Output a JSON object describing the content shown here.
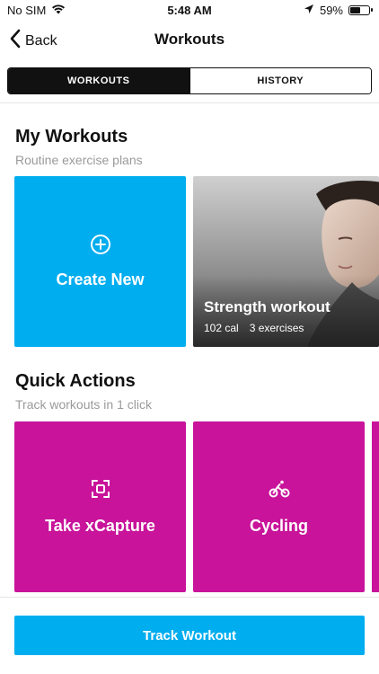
{
  "status_bar": {
    "carrier": "No SIM",
    "time": "5:48 AM",
    "battery": "59%",
    "battery_level": 0.59
  },
  "nav": {
    "back_label": "Back",
    "title": "Workouts"
  },
  "tabs": [
    {
      "label": "WORKOUTS",
      "active": true
    },
    {
      "label": "HISTORY",
      "active": false
    }
  ],
  "my_workouts": {
    "title": "My Workouts",
    "subtitle": "Routine exercise plans",
    "create_label": "Create New",
    "strength": {
      "title": "Strength workout",
      "calories": "102 cal",
      "exercises": "3 exercises"
    }
  },
  "quick_actions": {
    "title": "Quick Actions",
    "subtitle": "Track workouts in 1 click",
    "items": [
      {
        "label": "Take xCapture",
        "icon": "capture-icon"
      },
      {
        "label": "Cycling",
        "icon": "cycling-icon"
      }
    ]
  },
  "footer": {
    "track_label": "Track Workout"
  },
  "colors": {
    "accent_blue": "#00adef",
    "accent_magenta": "#c8139a"
  }
}
